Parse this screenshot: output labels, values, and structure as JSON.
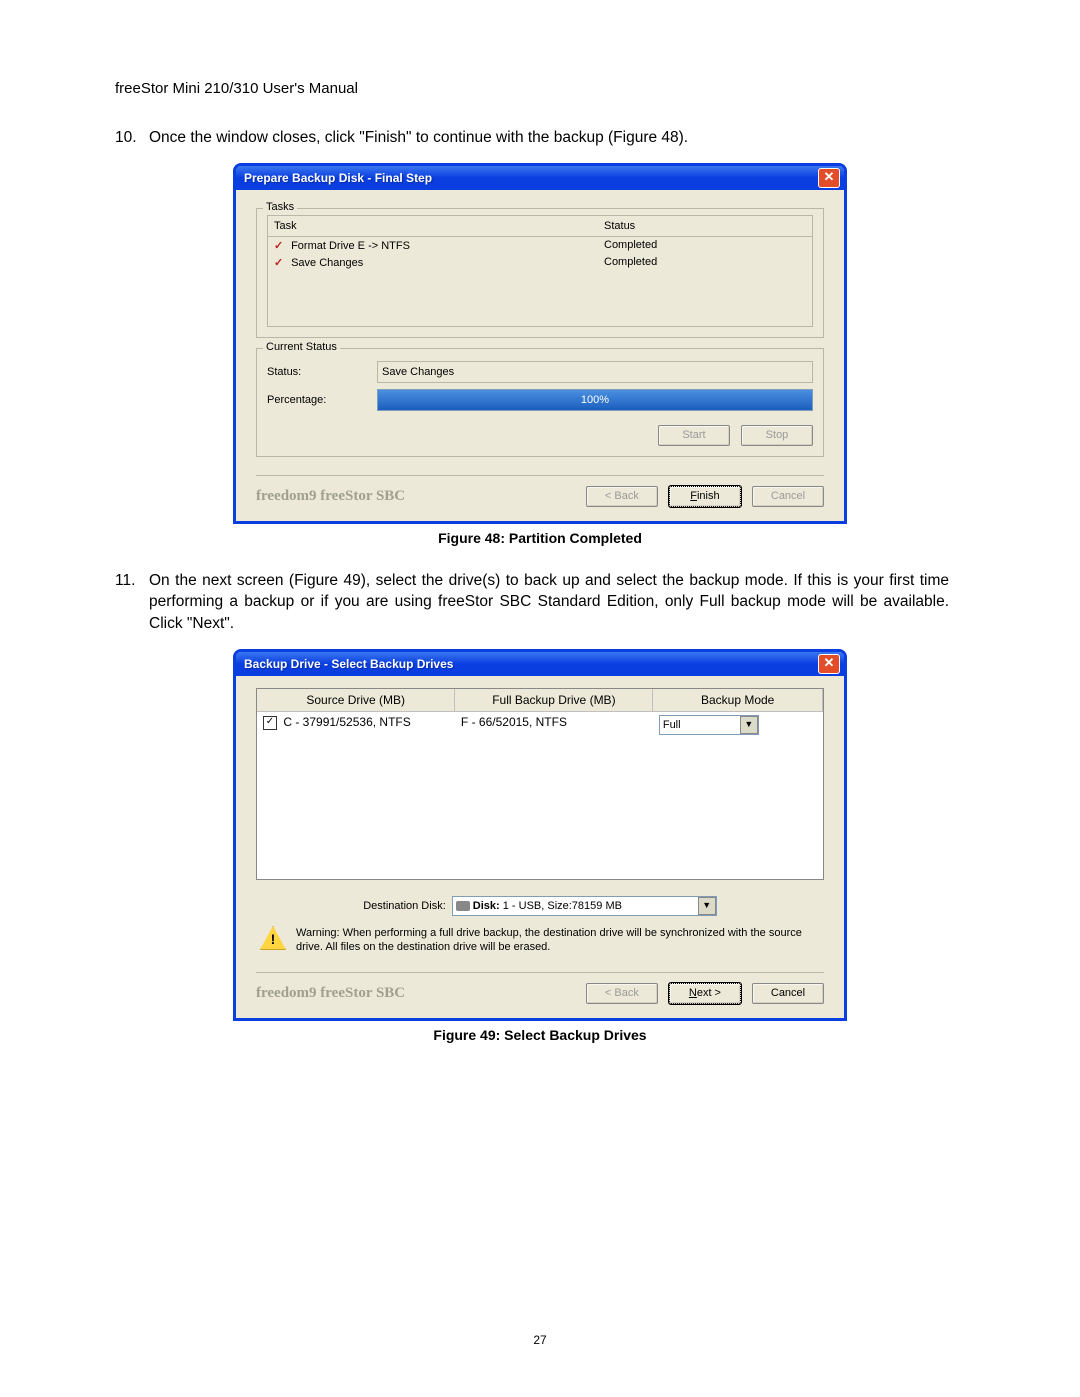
{
  "header": "freeStor Mini 210/310 User's Manual",
  "step10": {
    "num": "10.",
    "text": "Once the window closes, click \"Finish\" to continue with the backup (Figure 48)."
  },
  "dialog48": {
    "title": "Prepare Backup Disk - Final Step",
    "tasks_legend": "Tasks",
    "col_task": "Task",
    "col_status": "Status",
    "rows": [
      {
        "task": "Format Drive E -> NTFS",
        "status": "Completed"
      },
      {
        "task": "Save Changes",
        "status": "Completed"
      }
    ],
    "current_legend": "Current Status",
    "status_label": "Status:",
    "status_value": "Save Changes",
    "percent_label": "Percentage:",
    "percent_text": "100%",
    "btn_start": "Start",
    "btn_stop": "Stop",
    "brand": "freedom9 freeStor SBC",
    "btn_back": "< Back",
    "btn_finish": "Finish",
    "btn_cancel": "Cancel"
  },
  "caption48": "Figure 48: Partition Completed",
  "step11": {
    "num": "11.",
    "text": "On the next screen (Figure 49), select the drive(s) to back up and select the backup mode. If this is your first time performing a backup or if you are using freeStor SBC Standard Edition, only Full backup mode will be available.  Click \"Next\"."
  },
  "dialog49": {
    "title": "Backup Drive - Select Backup Drives",
    "col_source": "Source Drive (MB)",
    "col_full": "Full Backup Drive (MB)",
    "col_mode": "Backup Mode",
    "row_source": "C - 37991/52536, NTFS",
    "row_full": "F - 66/52015, NTFS",
    "row_mode": "Full",
    "dest_label": "Destination Disk:",
    "dest_value": "Disk: 1 - USB, Size:78159 MB",
    "warning": "Warning: When performing a full drive backup, the destination drive will be synchronized with the source drive. All files on the destination drive will be erased.",
    "brand": "freedom9 freeStor SBC",
    "btn_back": "< Back",
    "btn_next": "Next >",
    "btn_cancel": "Cancel"
  },
  "caption49": "Figure 49: Select Backup Drives",
  "page_num": "27"
}
